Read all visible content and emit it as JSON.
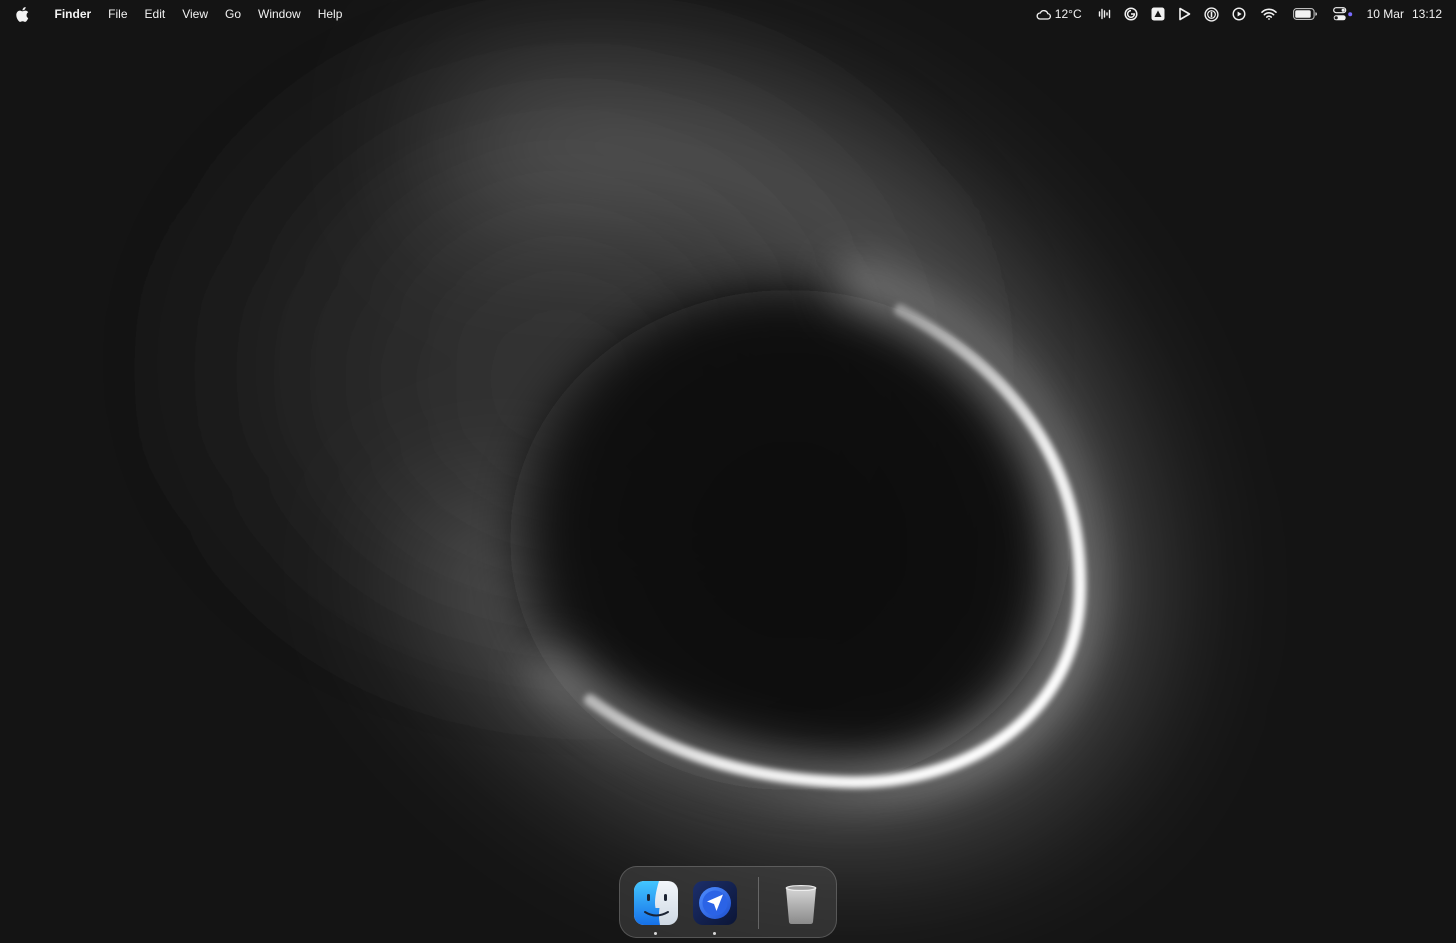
{
  "menubar": {
    "apple_icon": "apple-logo-icon",
    "app_name": "Finder",
    "menus": [
      "File",
      "Edit",
      "View",
      "Go",
      "Window",
      "Help"
    ],
    "status": {
      "weather_icon": "cloud-icon",
      "weather_temp": "12°C",
      "date": "10 Mar",
      "time": "13:12"
    }
  },
  "dock": {
    "apps": [
      {
        "name": "Finder",
        "icon": "finder-icon",
        "running": true
      },
      {
        "name": "Send",
        "icon": "paper-plane-app-icon",
        "running": true
      }
    ],
    "trash_icon": "trash-icon"
  },
  "colors": {
    "background": "#141414",
    "menubar_text": "#f2f2f2",
    "finder_blue": "#1e8ff5"
  }
}
